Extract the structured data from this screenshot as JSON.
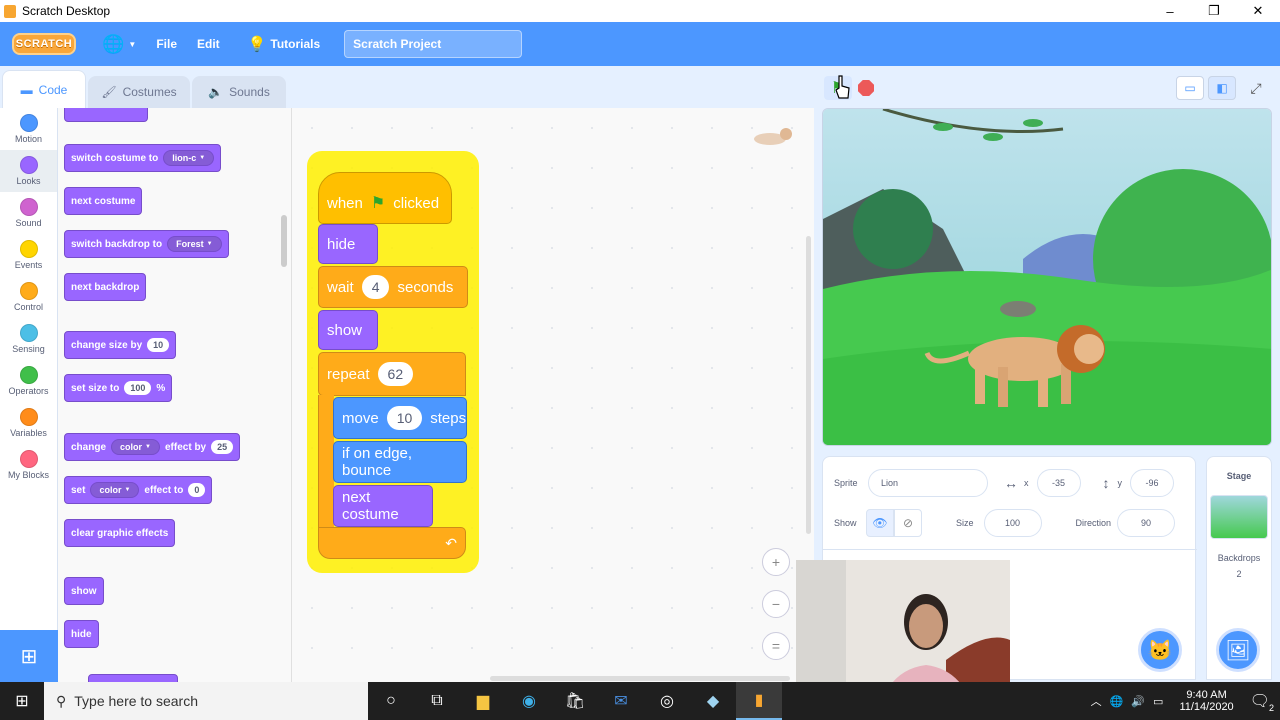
{
  "window": {
    "title": "Scratch Desktop",
    "minimize": "–",
    "maximize": "❐",
    "close": "✕"
  },
  "menubar": {
    "logo": "SCRATCH",
    "file": "File",
    "edit": "Edit",
    "tutorials": "Tutorials",
    "project_title": "Scratch Project"
  },
  "tabs": [
    {
      "label": "Code"
    },
    {
      "label": "Costumes"
    },
    {
      "label": "Sounds"
    }
  ],
  "categories": [
    {
      "label": "Motion",
      "color": "#4c97ff"
    },
    {
      "label": "Looks",
      "color": "#9966ff"
    },
    {
      "label": "Sound",
      "color": "#cf63cf"
    },
    {
      "label": "Events",
      "color": "#ffd500"
    },
    {
      "label": "Control",
      "color": "#ffab19"
    },
    {
      "label": "Sensing",
      "color": "#4cbfe6"
    },
    {
      "label": "Operators",
      "color": "#40bf4a"
    },
    {
      "label": "Variables",
      "color": "#ff8c1a"
    },
    {
      "label": "My Blocks",
      "color": "#ff6680"
    }
  ],
  "palette": {
    "switch_costume": "switch costume to",
    "costume_value": "lion-c",
    "next_costume": "next costume",
    "switch_backdrop": "switch backdrop to",
    "backdrop_value": "Forest",
    "next_backdrop": "next backdrop",
    "change_size": "change size by",
    "change_size_value": "10",
    "set_size": "set size to",
    "set_size_value": "100",
    "set_size_unit": "%",
    "change_effect": "change",
    "change_effect_dd": "color",
    "change_effect_by": "effect by",
    "change_effect_value": "25",
    "set_effect": "set",
    "set_effect_dd": "color",
    "set_effect_to": "effect to",
    "set_effect_value": "0",
    "clear_effects": "clear graphic effects",
    "show": "show",
    "hide": "hide"
  },
  "script": {
    "when": "when",
    "clicked": "clicked",
    "hide": "hide",
    "wait": "wait",
    "wait_value": "4",
    "seconds": "seconds",
    "show": "show",
    "repeat": "repeat",
    "repeat_value": "62",
    "move": "move",
    "move_value": "10",
    "steps": "steps",
    "bounce": "if on edge, bounce",
    "next_costume": "next costume"
  },
  "zoom": {
    "in": "+",
    "out": "−",
    "reset": "="
  },
  "sprite_info": {
    "sprite_label": "Sprite",
    "sprite_name": "Lion",
    "x_label": "x",
    "x_value": "-35",
    "y_label": "y",
    "y_value": "-96",
    "show_label": "Show",
    "size_label": "Size",
    "size_value": "100",
    "direction_label": "Direction",
    "direction_value": "90"
  },
  "stage_pane": {
    "title": "Stage",
    "backdrops_label": "Backdrops",
    "backdrops_count": "2"
  },
  "taskbar": {
    "search_placeholder": "Type here to search",
    "time": "9:40 AM",
    "date": "11/14/2020",
    "notifications": "2"
  },
  "colors": {
    "scratch_blue": "#4c97ff",
    "looks": "#9966ff",
    "control": "#ffab19",
    "events": "#ffbf00",
    "motion": "#4c97ff",
    "highlight": "#fff000"
  }
}
